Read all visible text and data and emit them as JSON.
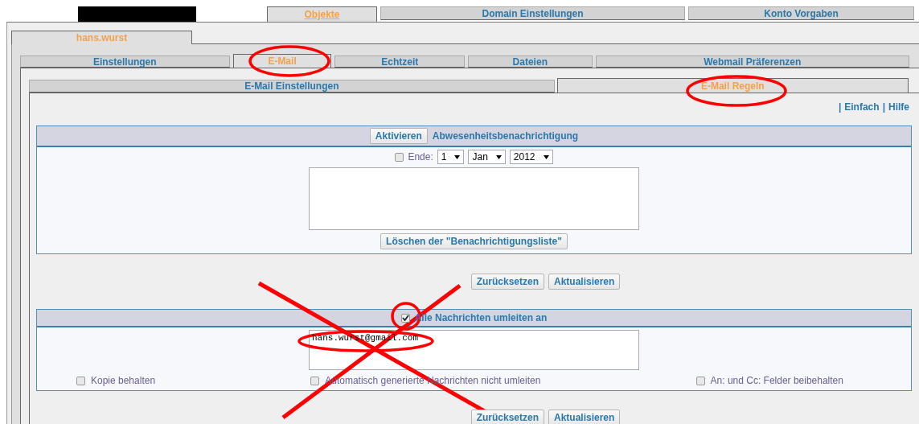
{
  "top_tabs": [
    {
      "label": "Objekte",
      "selected": true
    },
    {
      "label": "Domain Einstellungen",
      "selected": false
    },
    {
      "label": "Konto Vorgaben",
      "selected": false
    }
  ],
  "account_tab": {
    "label": "hans.wurst",
    "selected": true
  },
  "category_tabs": [
    {
      "label": "Einstellungen",
      "selected": false
    },
    {
      "label": "E-Mail",
      "selected": true
    },
    {
      "label": "Echtzeit",
      "selected": false
    },
    {
      "label": "Dateien",
      "selected": false
    },
    {
      "label": "Webmail Präferenzen",
      "selected": false
    }
  ],
  "sub_tabs": [
    {
      "label": "E-Mail Einstellungen",
      "selected": false
    },
    {
      "label": "E-Mail Regeln",
      "selected": true
    }
  ],
  "links": [
    {
      "separator": "|",
      "label": "Einfach"
    },
    {
      "separator": "|",
      "label": "Hilfe"
    }
  ],
  "autoresponder": {
    "activate_button": "Aktivieren",
    "title": "Abwesenheitsbenachrichtigung",
    "end": {
      "label": "Ende:",
      "checked": false,
      "day": "1",
      "month": "Jan",
      "year": "2012"
    },
    "clear_button": "Löschen der \"Benachrichtigungsliste\""
  },
  "buttons_1": [
    "Zurücksetzen",
    "Aktualisieren"
  ],
  "forward": {
    "label": "Alle Nachrichten umleiten an",
    "checked": true,
    "addresses": "hans.wurst@gmail.com",
    "options": [
      {
        "label": "Kopie behalten",
        "checked": false
      },
      {
        "label": "Automatisch generierte Nachrichten nicht umleiten",
        "checked": false
      },
      {
        "label": "An: und Cc: Felder beibehalten",
        "checked": false
      }
    ]
  },
  "buttons_2": [
    "Zurücksetzen",
    "Aktualisieren"
  ]
}
